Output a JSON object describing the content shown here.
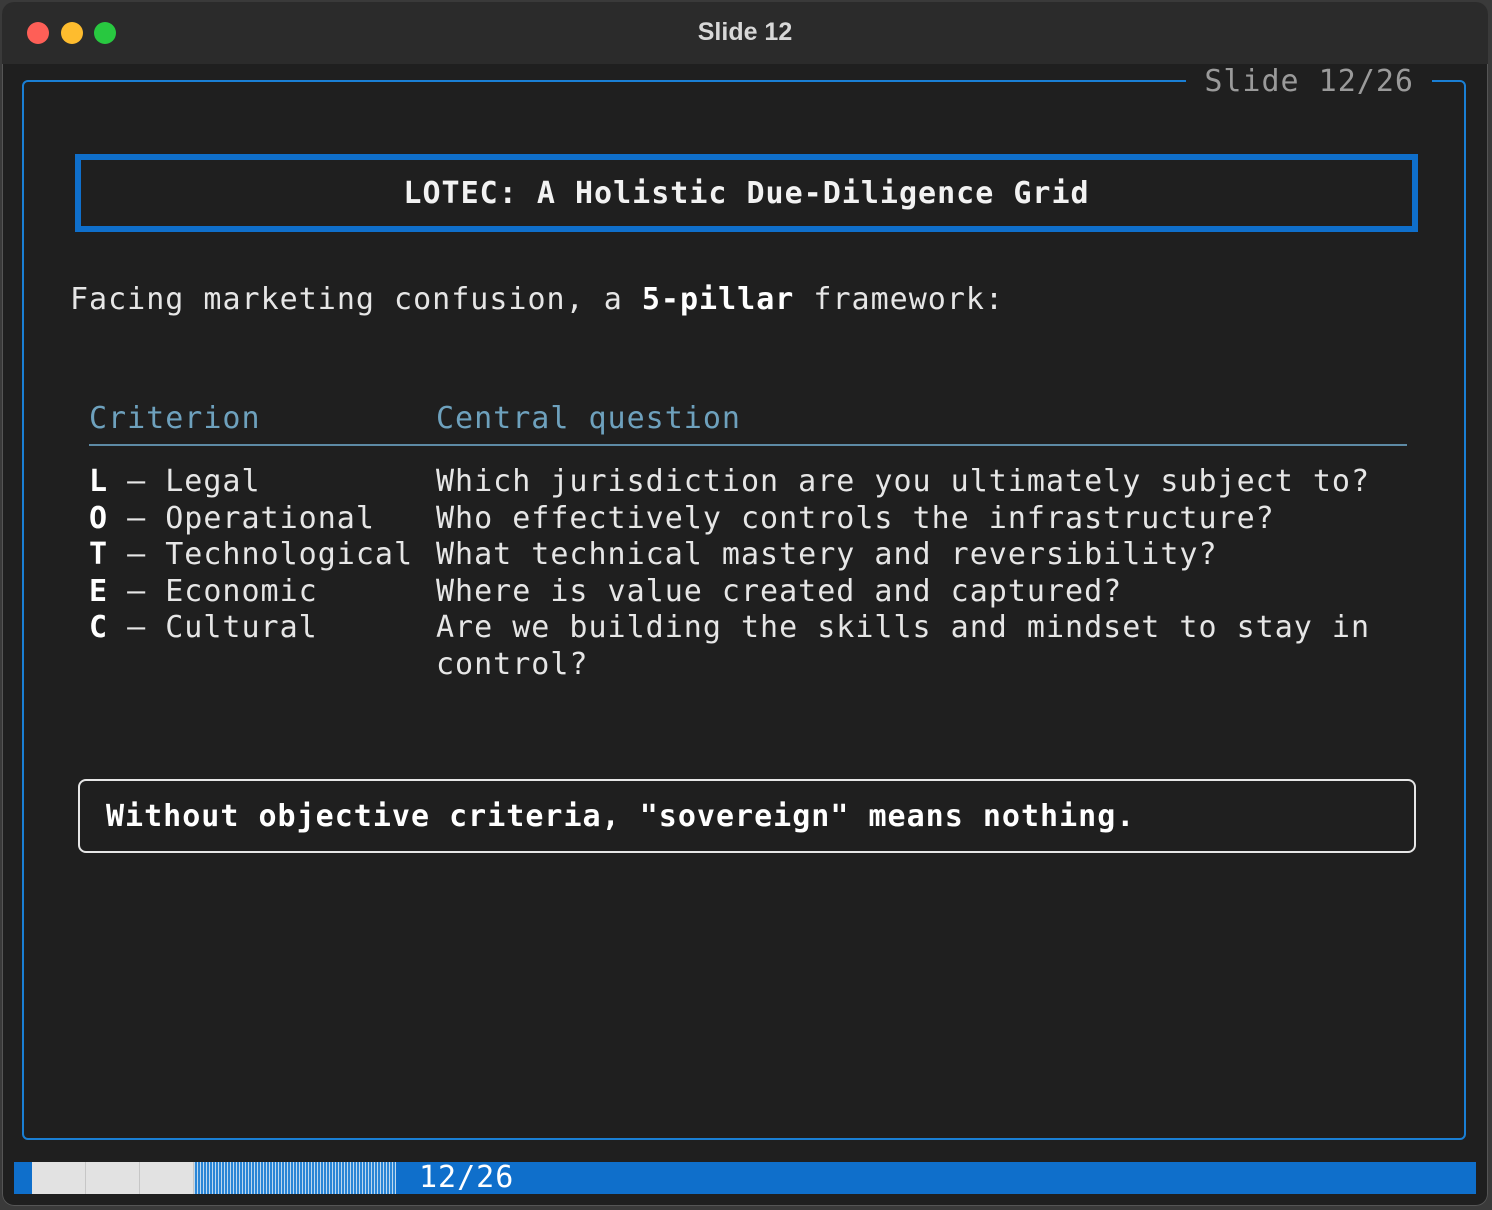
{
  "window": {
    "title": "Slide 12"
  },
  "slide": {
    "counter": "Slide 12/26",
    "title": "LOTEC: A Holistic Due-Diligence Grid",
    "intro_before": "Facing marketing confusion, a ",
    "intro_bold": "5-pillar",
    "intro_after": " framework:",
    "table": {
      "headers": [
        "Criterion",
        "Central question"
      ],
      "rows": [
        {
          "letter": "L",
          "name": " — Legal",
          "question": "Which jurisdiction are you ultimately subject to?"
        },
        {
          "letter": "O",
          "name": " — Operational",
          "question": "Who effectively controls the infrastructure?"
        },
        {
          "letter": "T",
          "name": " — Technological",
          "question": "What technical mastery and reversibility?"
        },
        {
          "letter": "E",
          "name": " — Economic",
          "question": "Where is value created and captured?"
        },
        {
          "letter": "C",
          "name": " — Cultural",
          "question": "Are we building the skills and mindset to stay in control?"
        }
      ]
    },
    "callout": "Without objective criteria, \"sovereign\" means nothing."
  },
  "status": {
    "page": "12/26",
    "progress_fraction": 0.4615,
    "accent_color": "#0f6fcb"
  }
}
